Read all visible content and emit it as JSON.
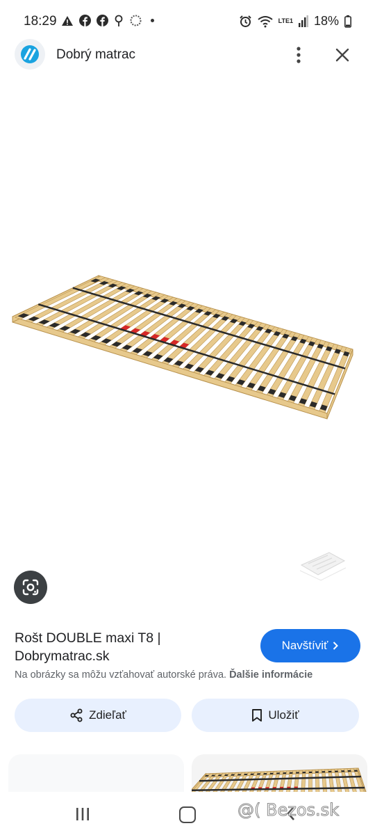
{
  "status_bar": {
    "time": "18:29",
    "battery": "18%",
    "network": "LTE1"
  },
  "header": {
    "site_name": "Dobrý matrac"
  },
  "result": {
    "title": "Rošt DOUBLE maxi T8 | Dobrymatrac.sk",
    "visit_label": "Navštíviť",
    "copyright_text": "Na obrázky sa môžu vzťahovať autorské práva.",
    "more_info_link": "Ďalšie informácie"
  },
  "actions": {
    "share_label": "Zdieľať",
    "save_label": "Uložiť"
  },
  "watermark": "@( Bezos.sk",
  "colors": {
    "accent": "#1a73e8",
    "pill_bg": "#e8f0fe",
    "wood": "#e7c98c",
    "wood_edge": "#b8924e",
    "strap": "#2a2a2a",
    "red_slider": "#d62828"
  },
  "icons": [
    "warning-icon",
    "facebook-icon",
    "location-icon",
    "sync-icon",
    "alarm-icon",
    "wifi-icon",
    "signal-icon",
    "battery-icon",
    "more-vert-icon",
    "close-icon",
    "lens-icon",
    "chevron-right-icon",
    "share-icon",
    "bookmark-icon",
    "recents-icon",
    "home-icon",
    "back-icon"
  ]
}
